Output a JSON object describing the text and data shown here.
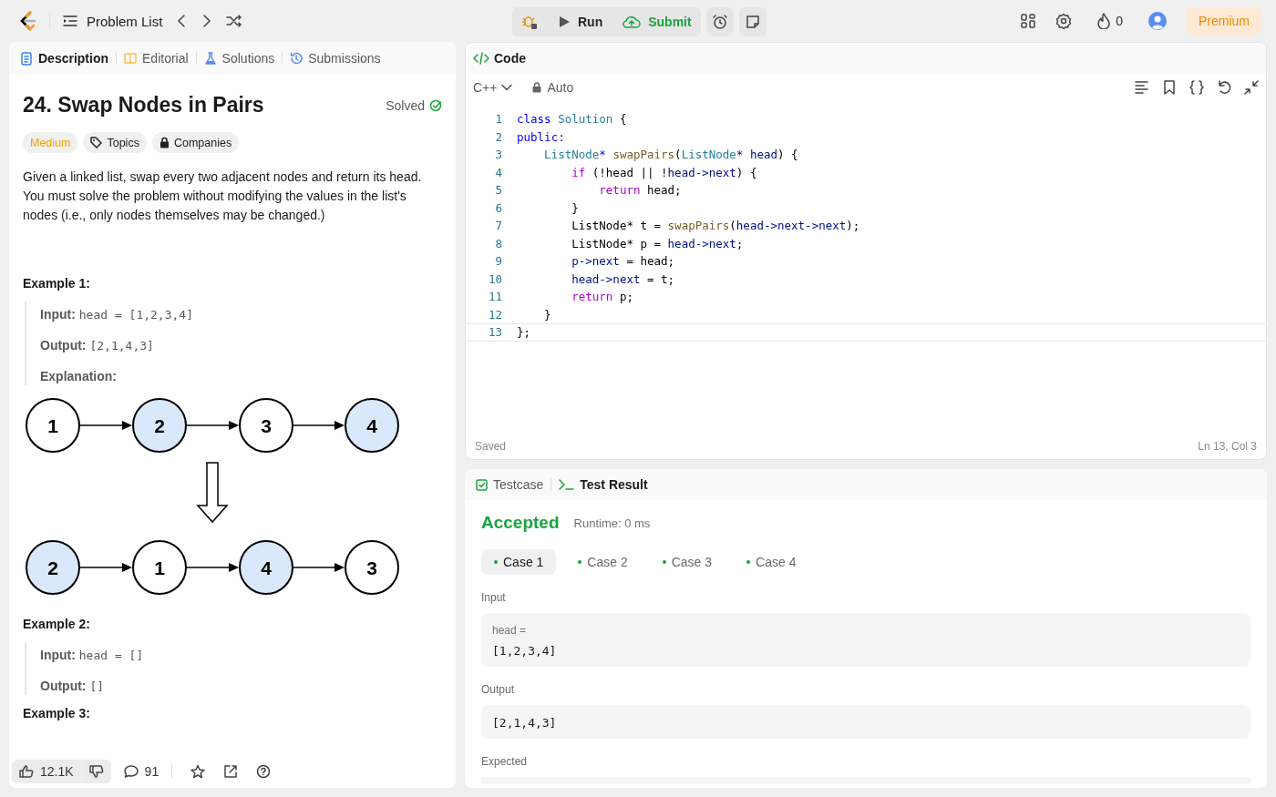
{
  "topbar": {
    "nav_title": "Problem List",
    "run": "Run",
    "submit": "Submit",
    "streak": "0",
    "premium": "Premium"
  },
  "left_panel": {
    "tabs": [
      {
        "label": "Description",
        "kind": "description",
        "selected": true
      },
      {
        "label": "Editorial",
        "kind": "editorial",
        "selected": false
      },
      {
        "label": "Solutions",
        "kind": "solutions",
        "selected": false
      },
      {
        "label": "Submissions",
        "kind": "submissions",
        "selected": false
      }
    ],
    "title": "24. Swap Nodes in Pairs",
    "status": "Solved",
    "tags": [
      {
        "label": "Medium",
        "kind": "difficulty"
      },
      {
        "label": "Topics",
        "kind": "topics"
      },
      {
        "label": "Companies",
        "kind": "companies"
      }
    ],
    "description": "Given a linked list, swap every two adjacent nodes and return its head. You must solve the problem without modifying the values in the list's nodes (i.e., only nodes themselves may be changed.)",
    "examples": [
      {
        "heading": "Example 1:",
        "lines": [
          {
            "label": "Input:",
            "value": "head = [1,2,3,4]",
            "kind": "code"
          },
          {
            "label": "Output:",
            "value": "[2,1,4,3]",
            "kind": "code"
          },
          {
            "label": "Explanation:",
            "kind": "label"
          }
        ],
        "diagram": [
          [
            {
              "value": "1",
              "highlighted": false
            },
            {
              "value": "2",
              "highlighted": true
            },
            {
              "value": "3",
              "highlighted": false
            },
            {
              "value": "4",
              "highlighted": true
            }
          ],
          [
            {
              "value": "2",
              "highlighted": true
            },
            {
              "value": "1",
              "highlighted": false
            },
            {
              "value": "4",
              "highlighted": true
            },
            {
              "value": "3",
              "highlighted": false
            }
          ]
        ]
      },
      {
        "heading": "Example 2:",
        "lines": [
          {
            "label": "Input:",
            "value": "head = []",
            "kind": "code"
          },
          {
            "label": "Output:",
            "value": "[]",
            "kind": "code"
          }
        ]
      },
      {
        "heading": "Example 3:"
      }
    ],
    "footer": {
      "likes": "12.1K",
      "comments": "91"
    }
  },
  "code_panel": {
    "title": "Code",
    "language": "C++",
    "mode": "Auto",
    "lines": [
      {
        "number": "1",
        "current": false,
        "tokens": [
          {
            "text": "class ",
            "kind": "keyword"
          },
          {
            "text": "Solution",
            "kind": "type"
          },
          {
            "text": " {",
            "kind": "plain"
          }
        ]
      },
      {
        "number": "2",
        "current": false,
        "tokens": [
          {
            "text": "public:",
            "kind": "keyword"
          }
        ]
      },
      {
        "number": "3",
        "current": false,
        "tokens": [
          {
            "text": "    ListNode",
            "kind": "type"
          },
          {
            "text": "* ",
            "kind": "keyword"
          },
          {
            "text": "swapPairs",
            "kind": "function"
          },
          {
            "text": "(",
            "kind": "plain"
          },
          {
            "text": "ListNode",
            "kind": "type"
          },
          {
            "text": "* ",
            "kind": "keyword"
          },
          {
            "text": "head",
            "kind": "variable"
          },
          {
            "text": ") {",
            "kind": "plain"
          }
        ]
      },
      {
        "number": "4",
        "current": false,
        "tokens": [
          {
            "text": "        if",
            "kind": "control"
          },
          {
            "text": " (!head || !",
            "kind": "plain"
          },
          {
            "text": "head->next",
            "kind": "variable"
          },
          {
            "text": ") {",
            "kind": "plain"
          }
        ]
      },
      {
        "number": "5",
        "current": false,
        "tokens": [
          {
            "text": "            return",
            "kind": "control"
          },
          {
            "text": " head;",
            "kind": "plain"
          }
        ]
      },
      {
        "number": "6",
        "current": false,
        "tokens": [
          {
            "text": "        }",
            "kind": "plain"
          }
        ]
      },
      {
        "number": "7",
        "current": false,
        "tokens": [
          {
            "text": "        ListNode* t = ",
            "kind": "plain"
          },
          {
            "text": "swapPairs",
            "kind": "function"
          },
          {
            "text": "(",
            "kind": "plain"
          },
          {
            "text": "head->next->next",
            "kind": "variable"
          },
          {
            "text": ");",
            "kind": "plain"
          }
        ]
      },
      {
        "number": "8",
        "current": false,
        "tokens": [
          {
            "text": "        ListNode* p = ",
            "kind": "plain"
          },
          {
            "text": "head->next",
            "kind": "variable"
          },
          {
            "text": ";",
            "kind": "plain"
          }
        ]
      },
      {
        "number": "9",
        "current": false,
        "tokens": [
          {
            "text": "        p->next",
            "kind": "variable"
          },
          {
            "text": " = head;",
            "kind": "plain"
          }
        ]
      },
      {
        "number": "10",
        "current": false,
        "tokens": [
          {
            "text": "        head->next",
            "kind": "variable"
          },
          {
            "text": " = t;",
            "kind": "plain"
          }
        ]
      },
      {
        "number": "11",
        "current": false,
        "tokens": [
          {
            "text": "        return",
            "kind": "control"
          },
          {
            "text": " p;",
            "kind": "plain"
          }
        ]
      },
      {
        "number": "12",
        "current": false,
        "tokens": [
          {
            "text": "    }",
            "kind": "plain"
          }
        ]
      },
      {
        "number": "13",
        "current": true,
        "tokens": [
          {
            "text": "};",
            "kind": "plain"
          }
        ]
      }
    ],
    "saved": "Saved",
    "cursor": "Ln 13, Col 3"
  },
  "result_panel": {
    "tabs": [
      {
        "label": "Testcase",
        "kind": "testcase",
        "selected": false
      },
      {
        "label": "Test Result",
        "kind": "result",
        "selected": true
      }
    ],
    "verdict": "Accepted",
    "runtime": "Runtime: 0 ms",
    "cases": [
      {
        "label": "Case 1",
        "selected": true
      },
      {
        "label": "Case 2",
        "selected": false
      },
      {
        "label": "Case 3",
        "selected": false
      },
      {
        "label": "Case 4",
        "selected": false
      }
    ],
    "input_label": "Input",
    "param_name": "head =",
    "input_value": "[1,2,3,4]",
    "output_label": "Output",
    "output_value": "[2,1,4,3]",
    "expected_label": "Expected"
  }
}
